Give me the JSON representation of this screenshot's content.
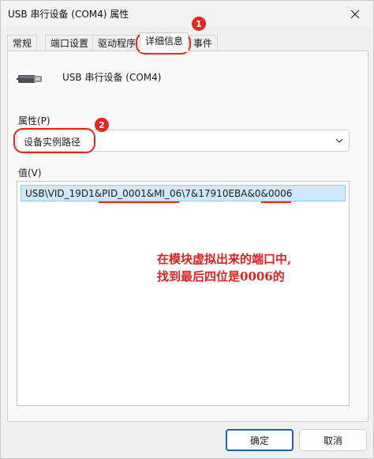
{
  "window": {
    "title": "USB 串行设备 (COM4) 属性"
  },
  "tabs": [
    {
      "label": "常规"
    },
    {
      "label": "端口设置"
    },
    {
      "label": "驱动程序"
    },
    {
      "label": "详细信息",
      "active": true
    },
    {
      "label": "事件"
    }
  ],
  "device": {
    "name": "USB 串行设备 (COM4)",
    "icon": "usb-plug-icon"
  },
  "property": {
    "label": "属性(P)",
    "selected": "设备实例路径"
  },
  "value": {
    "label": "值(V)",
    "rows": [
      "USB\\VID_19D1&PID_0001&MI_06\\7&17910EBA&0&0006"
    ]
  },
  "annotation": {
    "lines": [
      "在模块虚拟出来的端口中,",
      "找到最后四位是0006的"
    ],
    "badges": [
      "1",
      "2"
    ],
    "color": "#e8251f"
  },
  "buttons": {
    "ok": "确定",
    "cancel": "取消"
  }
}
